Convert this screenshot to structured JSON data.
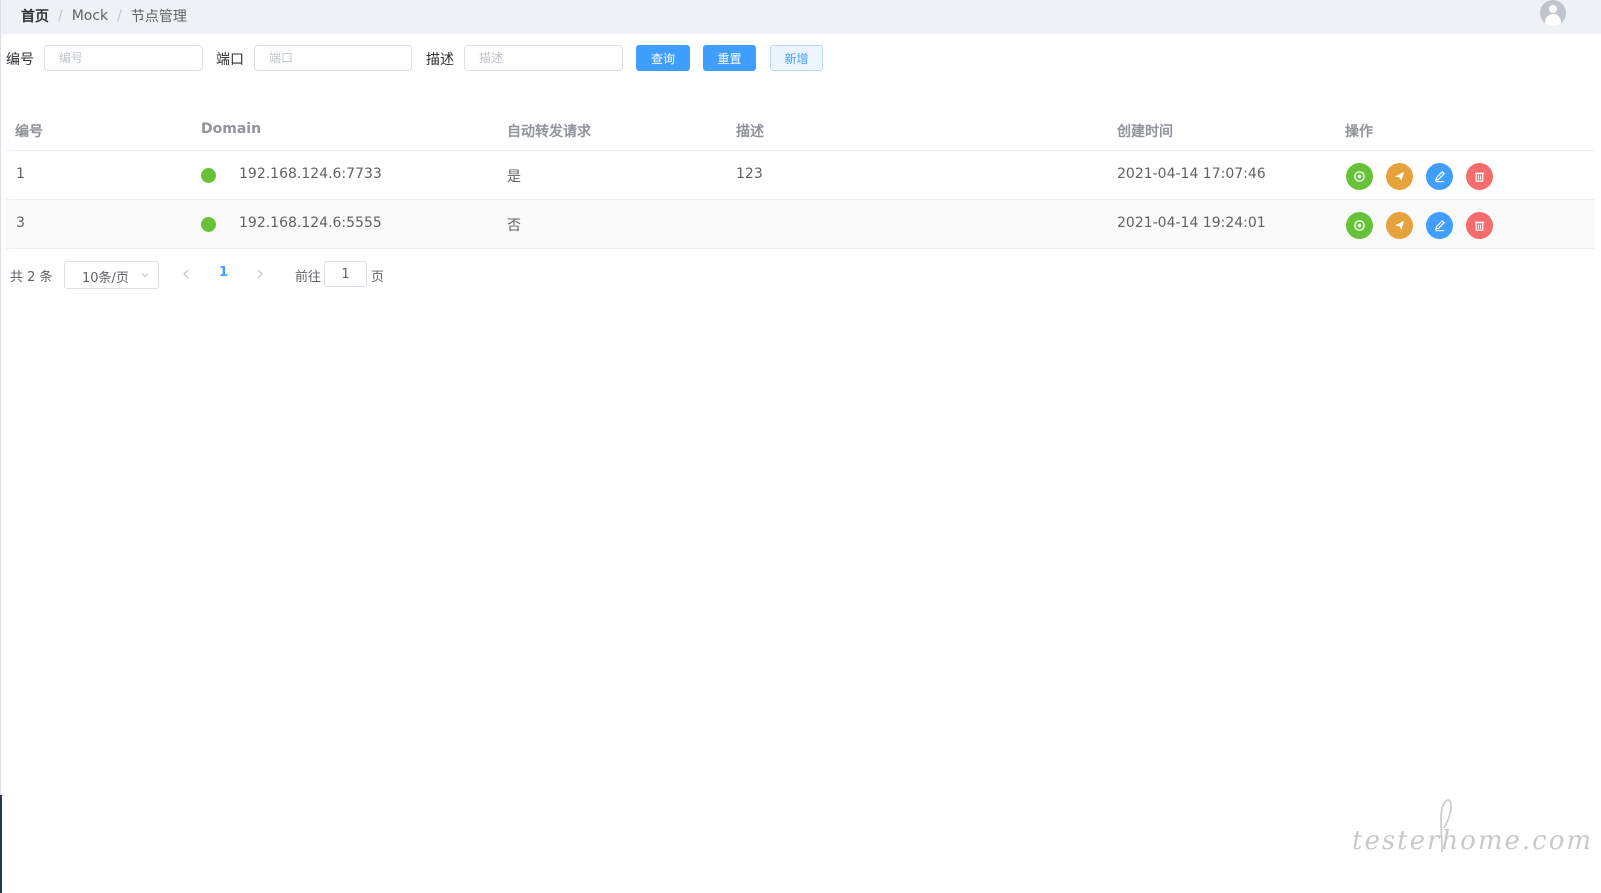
{
  "breadcrumb": {
    "items": [
      "首页",
      "Mock",
      "节点管理"
    ],
    "separator": "/"
  },
  "user": {
    "avatar_icon": "user-avatar-icon"
  },
  "filter": {
    "id_label": "编号",
    "id_placeholder": "编号",
    "id_value": "",
    "port_label": "端口",
    "port_placeholder": "端口",
    "port_value": "",
    "desc_label": "描述",
    "desc_placeholder": "描述",
    "desc_value": "",
    "query_button": "查询",
    "reset_button": "重置",
    "add_button": "新增"
  },
  "table": {
    "columns": [
      "编号",
      "Domain",
      "自动转发请求",
      "描述",
      "创建时间",
      "操作"
    ],
    "rows": [
      {
        "id": "1",
        "status_color": "#67c23a",
        "domain": "192.168.124.6:7733",
        "auto_forward": "是",
        "description": "123",
        "created": "2021-04-14 17:07:46"
      },
      {
        "id": "3",
        "status_color": "#67c23a",
        "domain": "192.168.124.6:5555",
        "auto_forward": "否",
        "description": "",
        "created": "2021-04-14 19:24:01"
      }
    ],
    "actions": [
      {
        "name": "detail",
        "icon": "target-icon",
        "color": "#67c23a"
      },
      {
        "name": "forward",
        "icon": "send-icon",
        "color": "#e6a23c"
      },
      {
        "name": "edit",
        "icon": "edit-icon",
        "color": "#409eff"
      },
      {
        "name": "delete",
        "icon": "trash-icon",
        "color": "#f56c6c"
      }
    ]
  },
  "pagination": {
    "total_text": "共 2 条",
    "page_size": "10条/页",
    "current_page": "1",
    "goto_label": "前往",
    "goto_value": "1",
    "goto_unit": "页"
  },
  "watermark": {
    "text": "testerhome.com"
  },
  "colors": {
    "primary": "#409eff",
    "success": "#67c23a",
    "warning": "#e6a23c",
    "danger": "#f56c6c",
    "header_bg": "#eef1f6"
  }
}
